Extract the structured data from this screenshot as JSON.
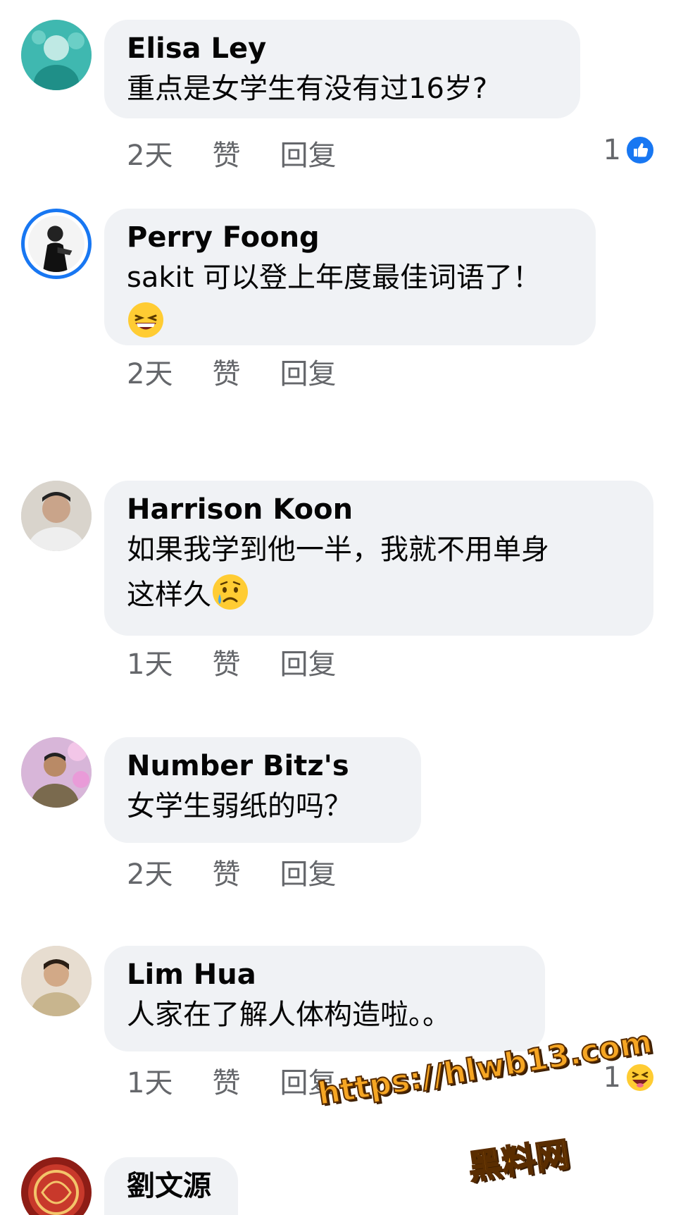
{
  "comments": [
    {
      "author": "Elisa Ley",
      "text": "重点是女学生有没有过16岁?",
      "time": "2天",
      "like": "赞",
      "reply": "回复",
      "reaction_count": "1",
      "reaction": "like"
    },
    {
      "author": "Perry Foong",
      "text": "sakit 可以登上年度最佳词语了！",
      "emoji": "grinning-squinting-face",
      "time": "2天",
      "like": "赞",
      "reply": "回复"
    },
    {
      "author": "Harrison Koon",
      "text_line1": "如果我学到他一半，我就不用单身",
      "text_line2": "这样久",
      "emoji": "sad-but-relieved-face",
      "time": "1天",
      "like": "赞",
      "reply": "回复"
    },
    {
      "author": "Number Bitz's",
      "text": "女学生弱纸的吗？",
      "time": "2天",
      "like": "赞",
      "reply": "回复"
    },
    {
      "author": "Lim Hua",
      "text": "人家在了解人体构造啦。。",
      "time": "1天",
      "like": "赞",
      "reply": "回复",
      "reaction_count": "1",
      "reaction": "haha"
    },
    {
      "author": "劉文源"
    }
  ],
  "watermark": {
    "url": "https://hlwb13.com",
    "name": "黑料网"
  },
  "colors": {
    "bubble": "#f0f2f5",
    "meta": "#65676b",
    "like_blue": "#1877f2",
    "watermark": "#f6a623"
  }
}
